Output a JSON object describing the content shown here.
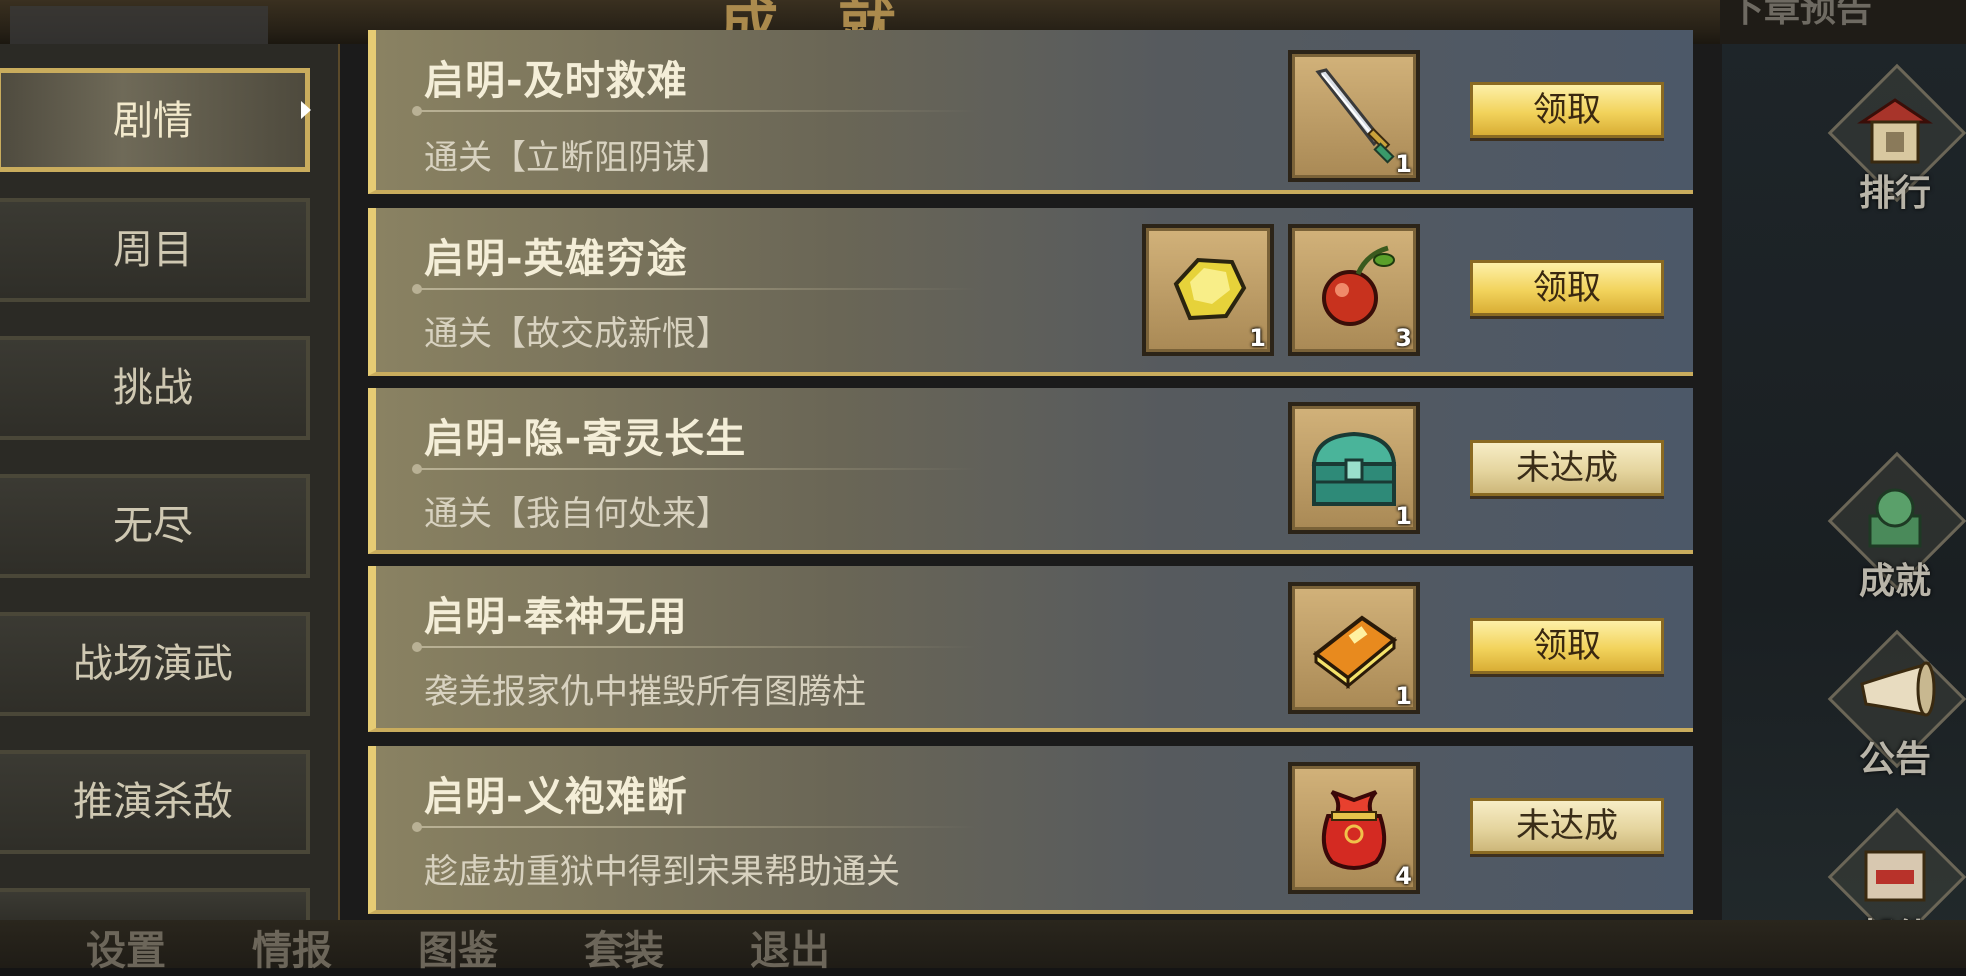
{
  "banner": {
    "title": "成就",
    "right_tab": "下章预告"
  },
  "left_tabs": [
    {
      "label": "剧情",
      "active": true
    },
    {
      "label": "周目",
      "active": false
    },
    {
      "label": "挑战",
      "active": false
    },
    {
      "label": "无尽",
      "active": false
    },
    {
      "label": "战场演武",
      "active": false
    },
    {
      "label": "推演杀敌",
      "active": false
    }
  ],
  "quests": [
    {
      "title": "启明-及时救难",
      "desc": "通关【立断阻阴谋】",
      "rewards": [
        {
          "icon": "sword-icon",
          "count": "1"
        }
      ],
      "button": "领取",
      "claimable": true
    },
    {
      "title": "启明-英雄穷途",
      "desc": "通关【故交成新恨】",
      "rewards": [
        {
          "icon": "gold-ore-icon",
          "count": "1"
        },
        {
          "icon": "red-fruit-icon",
          "count": "3"
        }
      ],
      "button": "领取",
      "claimable": true
    },
    {
      "title": "启明-隐-寄灵长生",
      "desc": "通关【我自何处来】",
      "rewards": [
        {
          "icon": "jade-chest-icon",
          "count": "1"
        }
      ],
      "button": "未达成",
      "claimable": false
    },
    {
      "title": "启明-奉神无用",
      "desc": "袭羌报家仇中摧毁所有图腾柱",
      "rewards": [
        {
          "icon": "book-icon",
          "count": "1"
        }
      ],
      "button": "领取",
      "claimable": true
    },
    {
      "title": "启明-义袍难断",
      "desc": "趁虚劫重狱中得到宋果帮助通关",
      "rewards": [
        {
          "icon": "red-pouch-icon",
          "count": "4"
        }
      ],
      "button": "未达成",
      "claimable": false
    }
  ],
  "side_buttons": [
    {
      "label": "排行",
      "icon": "ranking-icon"
    },
    {
      "label": "成就",
      "icon": "achievement-icon"
    },
    {
      "label": "公告",
      "icon": "horn-icon"
    },
    {
      "label": "邮件",
      "icon": "mail-icon"
    }
  ],
  "bottom_menu": [
    "设置",
    "情报",
    "图鉴",
    "套装",
    "退出"
  ],
  "colors": {
    "accent_gold": "#e6cc74",
    "button_gold": "#f2d35c",
    "row_bg_left": "#8a8262",
    "row_bg_right": "#4c5868"
  }
}
